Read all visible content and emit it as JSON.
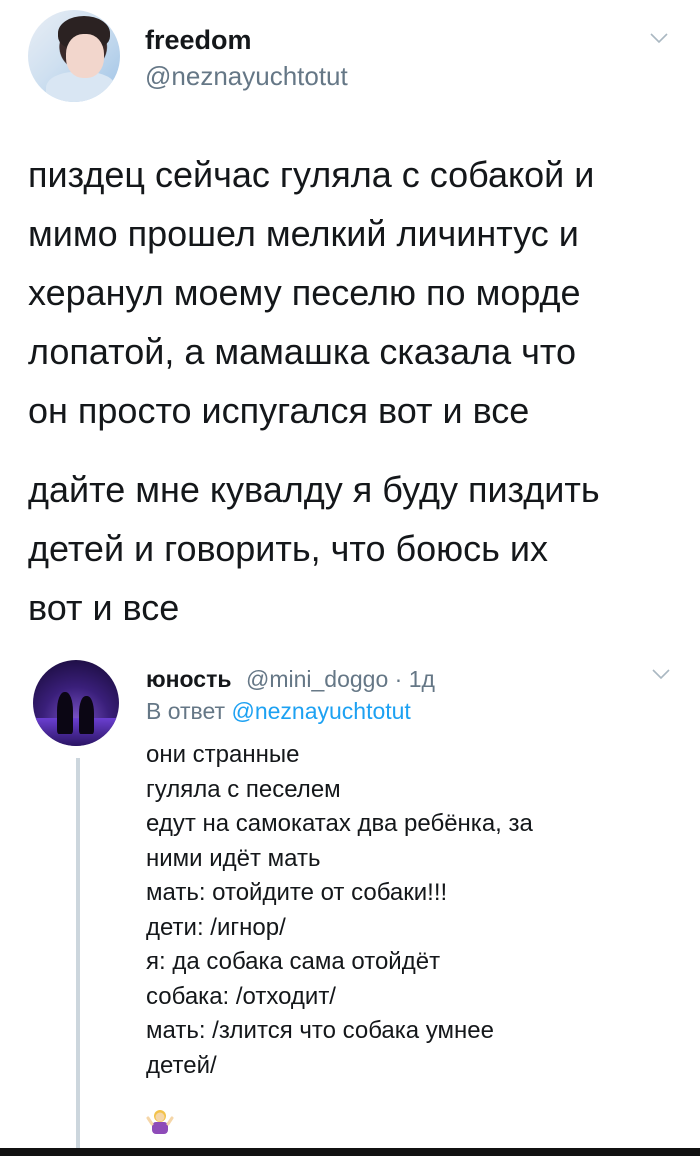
{
  "tweet": {
    "author_name": "freedom",
    "author_handle": "@neznayuchtotut",
    "paragraphs": [
      [
        "пиздец сейчас гуляла с собакой и",
        "мимо прошел мелкий личинтус и",
        "херанул моему песелю по морде",
        "лопатой, а мамашка сказала что",
        "он просто испугался вот и все"
      ],
      [
        "дайте мне кувалду я буду пиздить",
        "детей и говорить, что боюсь их",
        "вот и все"
      ]
    ]
  },
  "reply": {
    "author_name": "юность",
    "author_handle_time": "@mini_doggo · 1д",
    "reply_prefix": "В ответ",
    "reply_to": "@neznayuchtotut",
    "lines": [
      "они странные",
      "гуляла с песелем",
      "едут на самокатах два ребёнка, за",
      "ними идёт мать",
      "мать: отойдите от собаки!!!",
      "дети: /игнор/",
      "я: да собака сама отойдёт",
      "собака: /отходит/",
      "мать: /злится что собака умнее",
      "детей/"
    ],
    "emoji": "woman-shrugging-icon"
  },
  "colors": {
    "text": "#14171a",
    "secondary": "#657786",
    "link": "#1da1f2",
    "thread_line": "#ccd6dd"
  }
}
